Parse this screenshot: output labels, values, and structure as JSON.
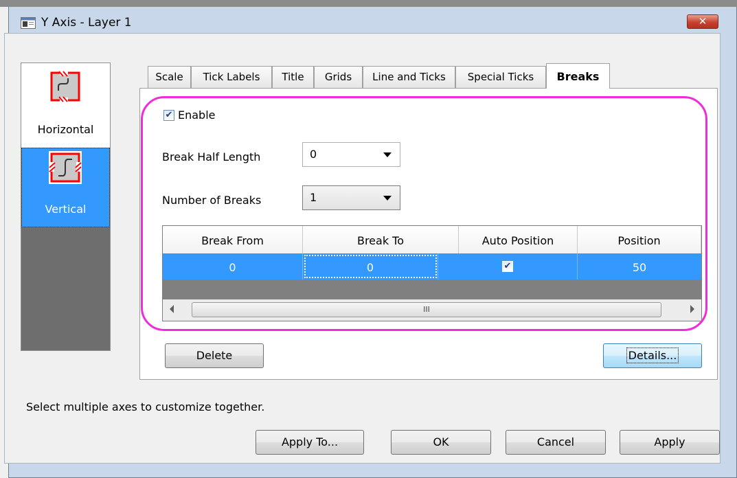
{
  "window": {
    "title": "Y Axis - Layer 1",
    "close_label": "✕"
  },
  "side_panel": {
    "items": [
      {
        "label": "Horizontal",
        "selected": false
      },
      {
        "label": "Vertical",
        "selected": true
      }
    ]
  },
  "tabs": [
    {
      "label": "Scale",
      "active": false
    },
    {
      "label": "Tick Labels",
      "active": false
    },
    {
      "label": "Title",
      "active": false
    },
    {
      "label": "Grids",
      "active": false
    },
    {
      "label": "Line and Ticks",
      "active": false
    },
    {
      "label": "Special Ticks",
      "active": false
    },
    {
      "label": "Breaks",
      "active": true
    }
  ],
  "breaks": {
    "enable_label": "Enable",
    "enable_checked": true,
    "half_length_label": "Break Half Length",
    "half_length_value": "0",
    "num_breaks_label": "Number of Breaks",
    "num_breaks_value": "1",
    "grid": {
      "columns": [
        "Break From",
        "Break To",
        "Auto Position",
        "Position"
      ],
      "rows": [
        {
          "break_from": "0",
          "break_to": "0",
          "auto_position": true,
          "position": "50"
        }
      ],
      "scroll_thumb_label": "III"
    },
    "delete_label": "Delete",
    "details_label": "Details..."
  },
  "status": {
    "text": "Select multiple axes to customize together."
  },
  "footer": {
    "apply_to_label": "Apply To...",
    "ok_label": "OK",
    "cancel_label": "Cancel",
    "apply_label": "Apply"
  },
  "colors": {
    "highlight": "#ee2cd9",
    "selection": "#3399ff",
    "window_frame": "#c8d8ea",
    "close_button": "#c7422f"
  }
}
